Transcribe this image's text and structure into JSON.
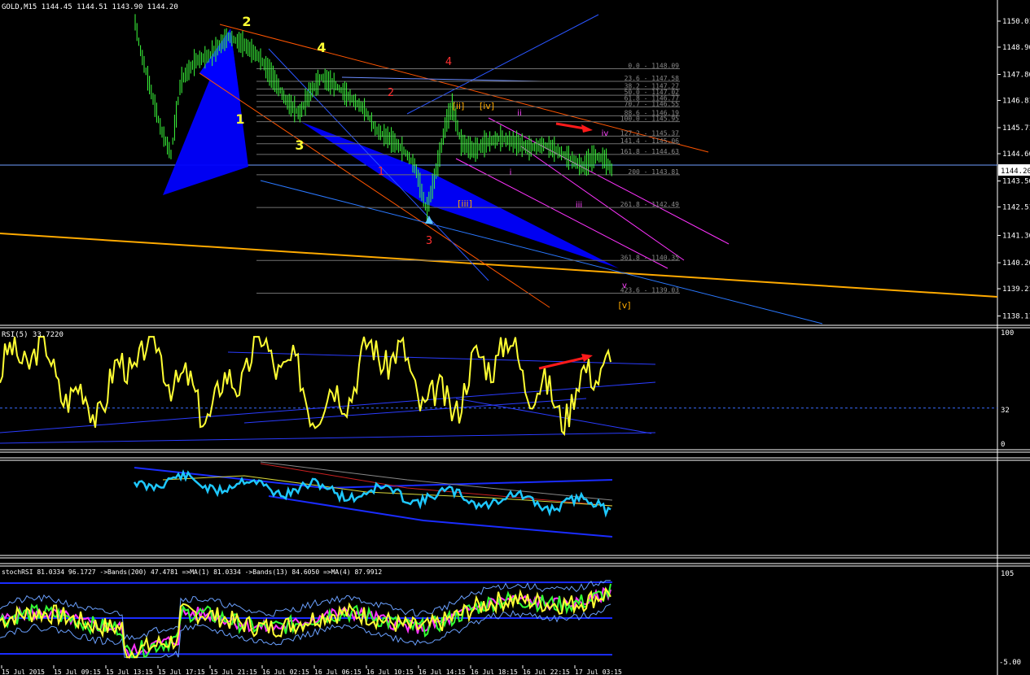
{
  "main": {
    "header": "GOLD,M15  1144.45 1144.51 1143.90 1144.20",
    "last_price": "1144.20",
    "price_ticks": [
      "1150.01",
      "1148.96",
      "1147.86",
      "1146.81",
      "1145.71",
      "1144.66",
      "1143.56",
      "1142.51",
      "1141.36",
      "1140.26",
      "1139.21",
      "1138.11"
    ],
    "fib_levels": [
      {
        "value": 1148.09,
        "label": "0.0 - 1148.09"
      },
      {
        "value": 1147.58,
        "label": "23.6 - 1147.58"
      },
      {
        "value": 1147.27,
        "label": "38.2 - 1147.27"
      },
      {
        "value": 1147.02,
        "label": "50.0 - 1147.02"
      },
      {
        "value": 1146.77,
        "label": "61.8 - 1146.77"
      },
      {
        "value": 1146.55,
        "label": "70.7 - 1146.55"
      },
      {
        "value": 1146.19,
        "label": "88.6 - 1146.19"
      },
      {
        "value": 1145.95,
        "label": "100.0 - 1145.95"
      },
      {
        "value": 1145.37,
        "label": "127.2 - 1145.37"
      },
      {
        "value": 1145.06,
        "label": "141.4 - 1145.06"
      },
      {
        "value": 1144.63,
        "label": "161.8 - 1144.63"
      },
      {
        "value": 1143.81,
        "label": "200 - 1143.81"
      },
      {
        "value": 1142.49,
        "label": "261.8 - 1142.49"
      },
      {
        "value": 1140.35,
        "label": "361.8 - 1140.35"
      },
      {
        "value": 1139.03,
        "label": "423.6 - 1139.03"
      }
    ],
    "wave_labels_yellow": [
      "1",
      "2",
      "3",
      "4"
    ],
    "wave_labels_red": [
      "1",
      "2",
      "3",
      "4"
    ],
    "wave_labels_orange": [
      "[ii]",
      "[iv]",
      "[iii]",
      "[v]"
    ],
    "wave_labels_magenta": [
      "i",
      "ii",
      "iii",
      "iv",
      "v"
    ]
  },
  "rsi": {
    "header": "RSI(5) 33.7220",
    "ticks": [
      "100",
      "32",
      "0"
    ]
  },
  "stoch": {
    "header": "stochRSI 81.0334 96.1727  ->Bands(200) 47.4781  =>MA(1) 81.0334  ->Bands(13) 84.6050  =>MA(4) 87.9912",
    "ticks": [
      "105",
      "-5.00"
    ]
  },
  "time_axis": [
    "15 Jul 2015",
    "15 Jul 09:15",
    "15 Jul 13:15",
    "15 Jul 17:15",
    "15 Jul 21:15",
    "16 Jul 02:15",
    "16 Jul 06:15",
    "16 Jul 10:15",
    "16 Jul 14:15",
    "16 Jul 18:15",
    "16 Jul 22:15",
    "17 Jul 03:15"
  ],
  "colors": {
    "background": "#000000",
    "candle": "#3cff3c",
    "rsi_line": "#ffff33",
    "cyan_line": "#1ec8ff",
    "harmonic_fill": "#0000ff",
    "orange_trend": "#ffaa00",
    "fib_line": "#707070",
    "red_arrow": "#ff1a1a"
  },
  "chart_data": [
    {
      "type": "line",
      "title": "GOLD,M15",
      "ylim": [
        1137.8,
        1150.6
      ],
      "ohlc_last": {
        "open": 1144.45,
        "high": 1144.51,
        "low": 1143.9,
        "close": 1144.2
      },
      "x": [
        0,
        6,
        12,
        18,
        24,
        30,
        36,
        42,
        48,
        54,
        60,
        66,
        72,
        78,
        84,
        90,
        96,
        102,
        108
      ],
      "values": [
        1150.2,
        1145.0,
        1143.0,
        1146.0,
        1148.0,
        1150.0,
        1149.0,
        1146.8,
        1145.8,
        1147.9,
        1147.3,
        1146.0,
        1144.5,
        1142.2,
        1147.7,
        1144.6,
        1145.9,
        1144.9,
        1144.2
      ],
      "series_name": ""
    },
    {
      "type": "line",
      "title": "RSI(5) 33.7220",
      "ylim": [
        0,
        100
      ],
      "x": [
        0,
        6,
        12,
        18,
        24,
        30,
        36,
        42,
        48,
        54,
        60,
        66,
        72,
        78,
        84,
        90,
        96,
        102,
        108
      ],
      "values": [
        55,
        70,
        60,
        10,
        60,
        85,
        50,
        15,
        80,
        45,
        60,
        70,
        50,
        30,
        60,
        90,
        40,
        20,
        34
      ]
    },
    {
      "type": "line",
      "title": "stochRSI",
      "ylim": [
        -5,
        105
      ],
      "x": [
        0,
        6,
        12,
        18,
        24,
        30,
        36,
        42,
        48,
        54,
        60,
        66,
        72,
        78,
        84,
        90,
        96,
        102,
        108
      ],
      "values": [
        55,
        45,
        40,
        5,
        30,
        50,
        45,
        40,
        50,
        40,
        45,
        40,
        30,
        50,
        60,
        70,
        80,
        90,
        81
      ]
    }
  ]
}
